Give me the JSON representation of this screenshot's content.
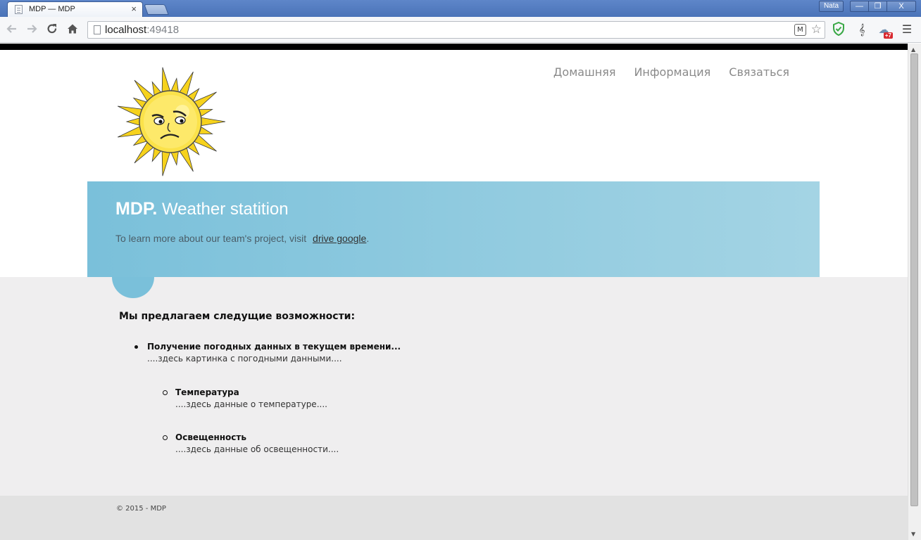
{
  "browser": {
    "tab_title": "MDP — MDP",
    "tab_close": "×",
    "profile_name": "Nata",
    "window_minimize": "—",
    "window_maximize": "❐",
    "window_close": "X",
    "url_host": "localhost",
    "url_port": ":49418",
    "ext_badge": "+7",
    "icons": [
      "back-arrow-icon",
      "forward-arrow-icon",
      "reload-icon",
      "home-icon",
      "page-icon",
      "star-icon",
      "shield-icon",
      "music-clef-icon",
      "weather-icon",
      "menu-icon"
    ]
  },
  "site": {
    "nav": {
      "home": "Домашняя",
      "info": "Информация",
      "contact": "Связаться"
    },
    "featured": {
      "title_bold": "MDP.",
      "title_rest": "Weather statition",
      "text": "To learn more about our team's project, visit",
      "link": "drive google",
      "period": "."
    },
    "main": {
      "heading": "Мы предлагаем следущие возможности:",
      "item1_title": "Получение погодных данных в текущем времени...",
      "item1_desc": "....здесь картинка с погодными данными....",
      "item2_title": "Температура",
      "item2_desc": "....здесь данные о температуре....",
      "item3_title": "Освещенность",
      "item3_desc": "....здесь данные об освещенности...."
    },
    "footer": "© 2015 - MDP"
  },
  "colors": {
    "featured_bg_start": "#7ac0da",
    "featured_bg_end": "#a4d4e4",
    "content_bg": "#efeeef",
    "footer_bg": "#e2e2e2",
    "nav_text": "#8a8a8a"
  }
}
